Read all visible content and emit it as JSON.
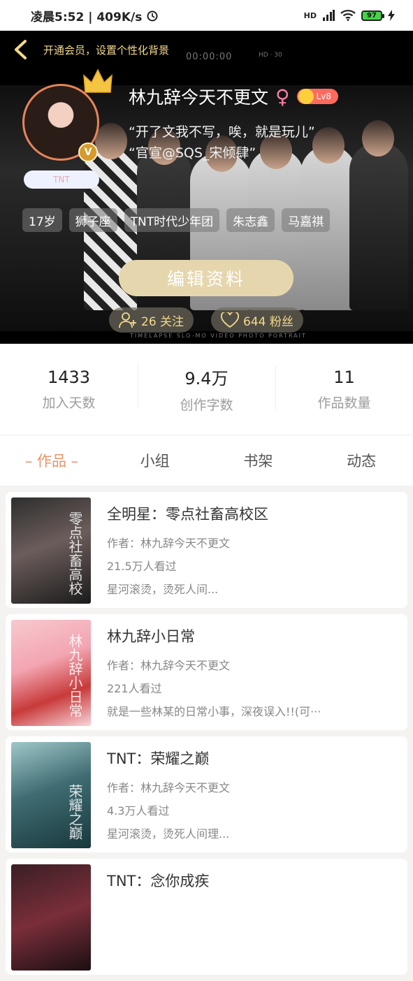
{
  "status_bar": {
    "time_speed": "凌晨5:52 | 409K/s",
    "network": "HD",
    "battery": "97"
  },
  "hero": {
    "vip_text": "开通会员，设置个性化背景",
    "camera_time": "00:00:00",
    "camera_info": "HD · 30",
    "name": "林九辞今天不更文",
    "gender_symbol": "♀",
    "level": "Lv8",
    "signature_1": "“开了文我不写，唉，就是玩儿”",
    "signature_2": "“官宣@SQS_宋倾肆”",
    "group_tag": "TNT",
    "tags": [
      "17岁",
      "狮子座",
      "TNT时代少年团",
      "朱志鑫",
      "马嘉祺"
    ],
    "edit_button": "编辑资料",
    "following": "26 关注",
    "followers": "644 粉丝",
    "camera_modes": "TIMELAPSE  SLO-MO  VIDEO  PHOTO  PORTRAIT",
    "colors": {
      "accent_gold": "#f3d98a",
      "edit_button": "#e5d6ae",
      "avatar_ring": "#e7845a"
    }
  },
  "stats": [
    {
      "value": "1433",
      "label": "加入天数"
    },
    {
      "value": "9.4万",
      "label": "创作字数"
    },
    {
      "value": "11",
      "label": "作品数量"
    }
  ],
  "tabs": [
    "– 作品 –",
    "小组",
    "书架",
    "动态"
  ],
  "books": [
    {
      "title": "全明星：零点社畜高校区",
      "author": "作者：林九辞今天不更文",
      "views": "21.5万人看过",
      "desc": "星河滚烫，烫死人间...",
      "cover_text": "零点社畜高校"
    },
    {
      "title": "林九辞小日常",
      "author": "作者：林九辞今天不更文",
      "views": "221人看过",
      "desc": "就是一些林某的日常小事，深夜误入!!(可···",
      "cover_text": "林九辞小日常"
    },
    {
      "title": "TNT：荣耀之巅",
      "author": "作者：林九辞今天不更文",
      "views": "4.3万人看过",
      "desc": "星河滚烫，烫死人间理...",
      "cover_text": "荣耀之巅"
    },
    {
      "title": "TNT：念你成疾",
      "author": "",
      "views": "",
      "desc": "",
      "cover_text": ""
    }
  ]
}
